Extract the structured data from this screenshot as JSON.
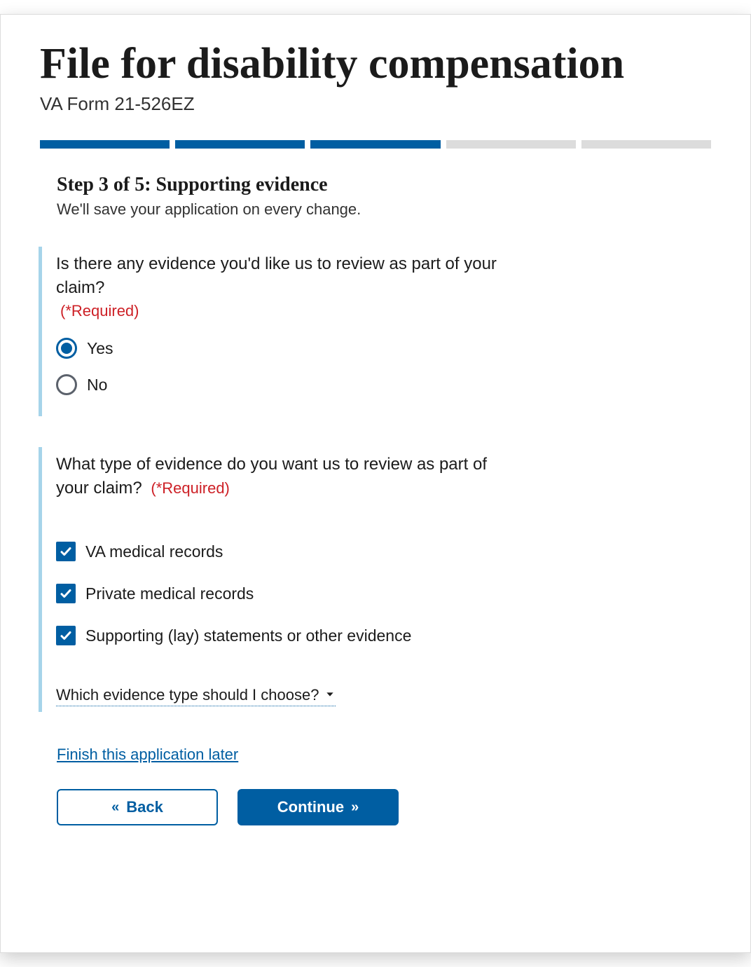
{
  "header": {
    "title": "File for disability compensation",
    "subtitle": "VA Form 21-526EZ"
  },
  "progress": {
    "total": 5,
    "current": 3
  },
  "step": {
    "heading": "Step 3 of 5: Supporting evidence",
    "save_note": "We'll save your application on every change."
  },
  "q1": {
    "text": "Is there any evidence you'd like us to review as part of your claim?",
    "required_label": "(*Required)",
    "options": {
      "yes": "Yes",
      "no": "No"
    },
    "selected": "yes"
  },
  "q2": {
    "text": "What type of evidence do you want us to review as part of your claim?",
    "required_label": "(*Required)",
    "options": [
      {
        "key": "va_records",
        "label": "VA medical records",
        "checked": true
      },
      {
        "key": "private_records",
        "label": "Private medical records",
        "checked": true
      },
      {
        "key": "lay_statements",
        "label": "Supporting (lay) statements or other evidence",
        "checked": true
      }
    ]
  },
  "expander": {
    "label": "Which evidence type should I choose?"
  },
  "finish_later": "Finish this application later",
  "buttons": {
    "back": "Back",
    "continue": "Continue"
  }
}
